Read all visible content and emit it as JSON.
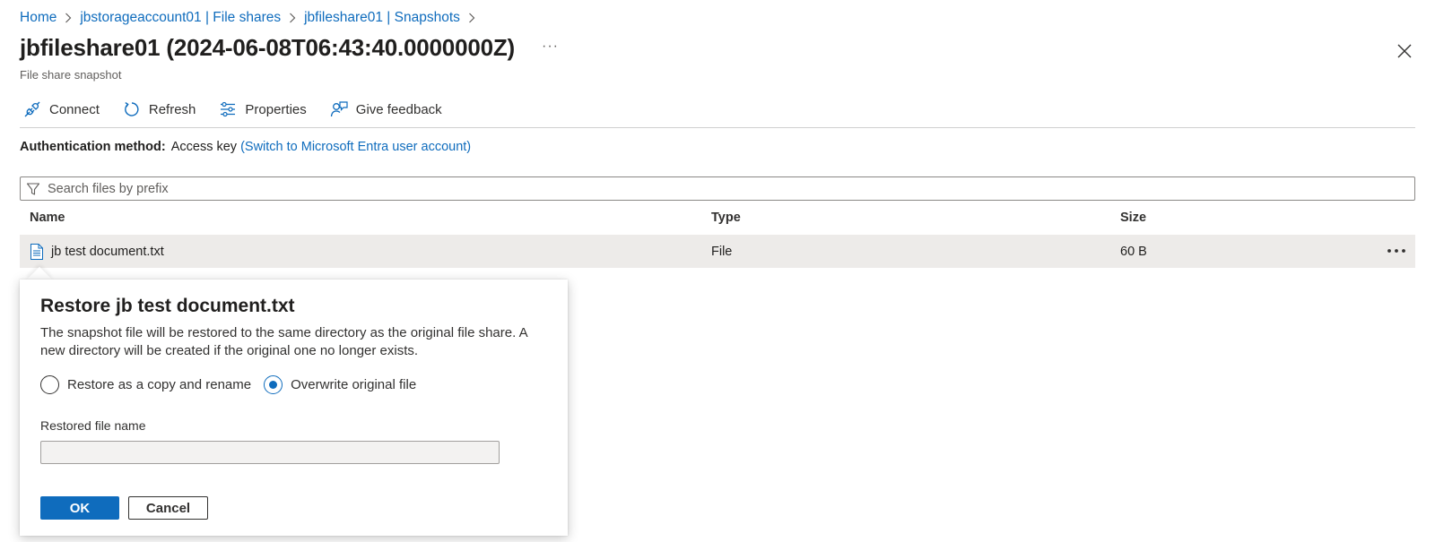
{
  "breadcrumb": [
    {
      "label": "Home"
    },
    {
      "label": "jbstorageaccount01 | File shares"
    },
    {
      "label": "jbfileshare01 | Snapshots"
    }
  ],
  "header": {
    "title": "jbfileshare01 (2024-06-08T06:43:40.0000000Z)",
    "more": "···",
    "subtitle": "File share snapshot"
  },
  "toolbar": {
    "connect_label": "Connect",
    "refresh_label": "Refresh",
    "properties_label": "Properties",
    "feedback_label": "Give feedback"
  },
  "auth": {
    "label": "Authentication method:",
    "value": "Access key",
    "switch_link": "(Switch to Microsoft Entra user account)"
  },
  "search": {
    "placeholder": "Search files by prefix",
    "value": ""
  },
  "table": {
    "columns": [
      "Name",
      "Type",
      "Size"
    ],
    "rows": [
      {
        "name": "jb test document.txt",
        "type": "File",
        "size": "60 B"
      }
    ]
  },
  "restore_dialog": {
    "title": "Restore jb test document.txt",
    "description": "The snapshot file will be restored to the same directory as the original file share. A new directory will be created if the original one no longer exists.",
    "options": [
      {
        "label": "Restore as a copy and rename",
        "checked": false
      },
      {
        "label": "Overwrite original file",
        "checked": true
      }
    ],
    "field_label": "Restored file name",
    "field_value": "",
    "ok_label": "OK",
    "cancel_label": "Cancel"
  },
  "colors": {
    "link": "#0f6cbd",
    "primary_button": "#0f6cbd",
    "selected_row": "#edebe9"
  }
}
